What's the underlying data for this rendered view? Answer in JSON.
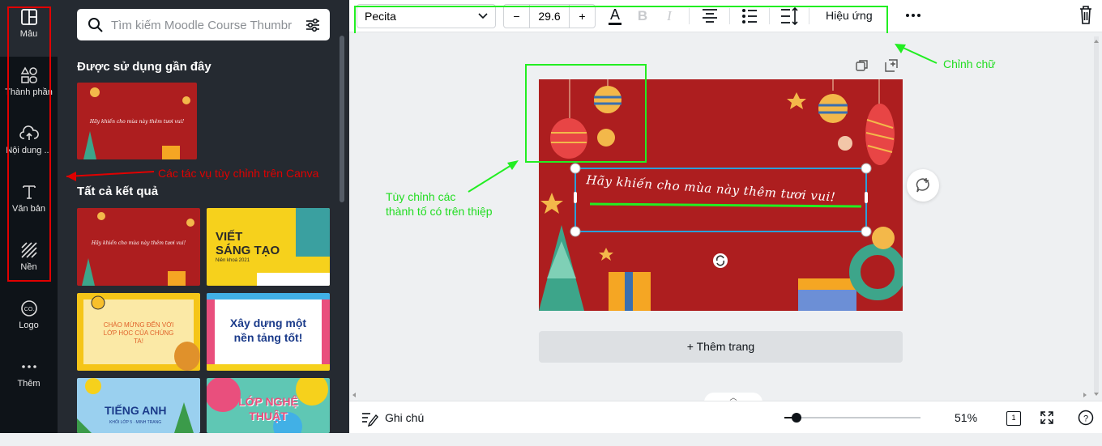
{
  "sidebar": {
    "items": [
      {
        "label": "Mẫu",
        "icon": "template-icon"
      },
      {
        "label": "Thành phần",
        "icon": "elements-icon"
      },
      {
        "label": "Nội dung ...",
        "icon": "upload-cloud-icon"
      },
      {
        "label": "Văn bản",
        "icon": "text-icon"
      },
      {
        "label": "Nền",
        "icon": "background-pattern-icon"
      },
      {
        "label": "Logo",
        "icon": "logo-icon"
      },
      {
        "label": "Thêm",
        "icon": "more-dots-icon"
      }
    ]
  },
  "panel": {
    "search_placeholder": "Tìm kiếm Moodle Course Thumbr",
    "recent_heading": "Được sử dụng gần đây",
    "results_heading": "Tất cả kết quả",
    "thumbnails": [
      {
        "text": "",
        "bg": "#ad1e1f"
      },
      {
        "text": "VIẾT SÁNG TẠO",
        "sub": "Niên khoá 2021",
        "bg": "#f6d11c"
      },
      {
        "text": "CHÀO MỪNG ĐẾN VỚI LỚP HỌC CỦA CHÚNG TA!",
        "bg": "#fbe9a6"
      },
      {
        "text": "Xây dựng một nền tảng tốt!",
        "bg": "#cde7f5"
      },
      {
        "text": "TIẾNG ANH",
        "sub": "KHỐI LỚP 5 · MINH TRANG",
        "bg": "#9ad0ef"
      },
      {
        "text": "LỚP NGHỆ THUẬT",
        "bg": "#5fc7b4"
      }
    ]
  },
  "toolbar": {
    "font_name": "Pecita",
    "font_size": "29.6",
    "minus_label": "−",
    "plus_label": "+",
    "effects_label": "Hiệu ứng"
  },
  "canvas": {
    "card_text": "Hãy khiến cho mùa này thêm tươi vui!",
    "add_page_label": "+ Thêm trang"
  },
  "bottombar": {
    "notes_label": "Ghi chú",
    "zoom_value": "51%",
    "page_count": "1",
    "zoom_fraction": 0.09
  },
  "annotations": {
    "left_arrow_text": "Các tác vụ tùy chỉnh trên Canva",
    "toolbar_note": "Chỉnh chữ",
    "canvas_note_line1": "Tùy chỉnh các",
    "canvas_note_line2": "thành tố có trên thiệp"
  },
  "colors": {
    "rail_bg": "#0e1318",
    "panel_bg": "#252a31",
    "card_red": "#ad1e1f",
    "selection": "#2b9fd9",
    "annot_red": "#e00000",
    "annot_green": "#22ee22"
  }
}
